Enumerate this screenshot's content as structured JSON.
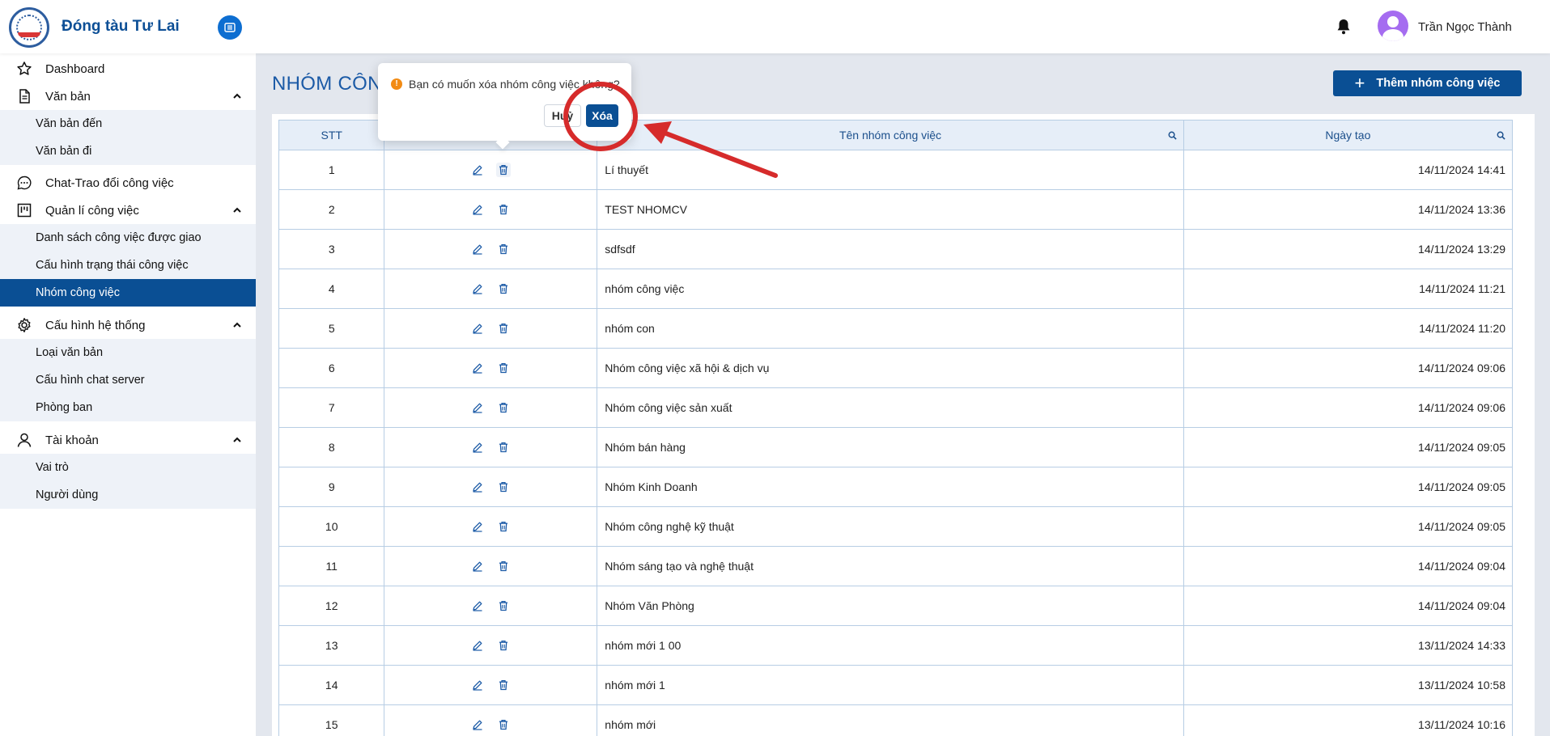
{
  "app": {
    "brand": "Đóng tàu Tư Lai"
  },
  "user": {
    "name": "Trần Ngọc Thành"
  },
  "sidebar": {
    "dashboard": "Dashboard",
    "van_ban": {
      "label": "Văn bản",
      "children": [
        "Văn bản đến",
        "Văn bản đi"
      ]
    },
    "chat": "Chat-Trao đổi công việc",
    "quan_li": {
      "label": "Quản lí công việc",
      "children": [
        "Danh sách công việc được giao",
        "Cấu hình trạng thái công việc",
        "Nhóm công việc"
      ]
    },
    "cau_hinh": {
      "label": "Cấu hình hệ thống",
      "children": [
        "Loại văn bản",
        "Cấu hình chat server",
        "Phòng ban"
      ]
    },
    "tai_khoan": {
      "label": "Tài khoản",
      "children": [
        "Vai trò",
        "Người dùng"
      ]
    }
  },
  "main": {
    "title": "NHÓM CÔNG VIỆC",
    "add_button": "Thêm nhóm công việc"
  },
  "table": {
    "headers": {
      "stt": "STT",
      "name": "Tên nhóm công việc",
      "date": "Ngày tạo"
    },
    "rows": [
      {
        "stt": "1",
        "name": "Lí thuyết",
        "date": "14/11/2024 14:41"
      },
      {
        "stt": "2",
        "name": "TEST NHOMCV",
        "date": "14/11/2024 13:36"
      },
      {
        "stt": "3",
        "name": "sdfsdf",
        "date": "14/11/2024 13:29"
      },
      {
        "stt": "4",
        "name": "nhóm công việc",
        "date": "14/11/2024 11:21"
      },
      {
        "stt": "5",
        "name": "nhóm con",
        "date": "14/11/2024 11:20"
      },
      {
        "stt": "6",
        "name": "Nhóm công việc xã hội & dịch vụ",
        "date": "14/11/2024 09:06"
      },
      {
        "stt": "7",
        "name": "Nhóm công việc sản xuất",
        "date": "14/11/2024 09:06"
      },
      {
        "stt": "8",
        "name": "Nhóm bán hàng",
        "date": "14/11/2024 09:05"
      },
      {
        "stt": "9",
        "name": "Nhóm Kinh Doanh",
        "date": "14/11/2024 09:05"
      },
      {
        "stt": "10",
        "name": "Nhóm công nghệ kỹ thuật",
        "date": "14/11/2024 09:05"
      },
      {
        "stt": "11",
        "name": "Nhóm sáng tạo và nghệ thuật",
        "date": "14/11/2024 09:04"
      },
      {
        "stt": "12",
        "name": "Nhóm Văn Phòng",
        "date": "14/11/2024 09:04"
      },
      {
        "stt": "13",
        "name": "nhóm mới 1 00",
        "date": "13/11/2024 14:33"
      },
      {
        "stt": "14",
        "name": "nhóm mới 1",
        "date": "13/11/2024 10:58"
      },
      {
        "stt": "15",
        "name": "nhóm mới",
        "date": "13/11/2024 10:16"
      }
    ]
  },
  "popconfirm": {
    "message": "Bạn có muốn xóa nhóm công việc không?",
    "cancel": "Huỷ",
    "ok": "Xóa"
  },
  "colors": {
    "primary": "#0a4f94",
    "accent": "#0d6ed1",
    "annotation": "#d62b2b",
    "warning": "#f28b14"
  }
}
